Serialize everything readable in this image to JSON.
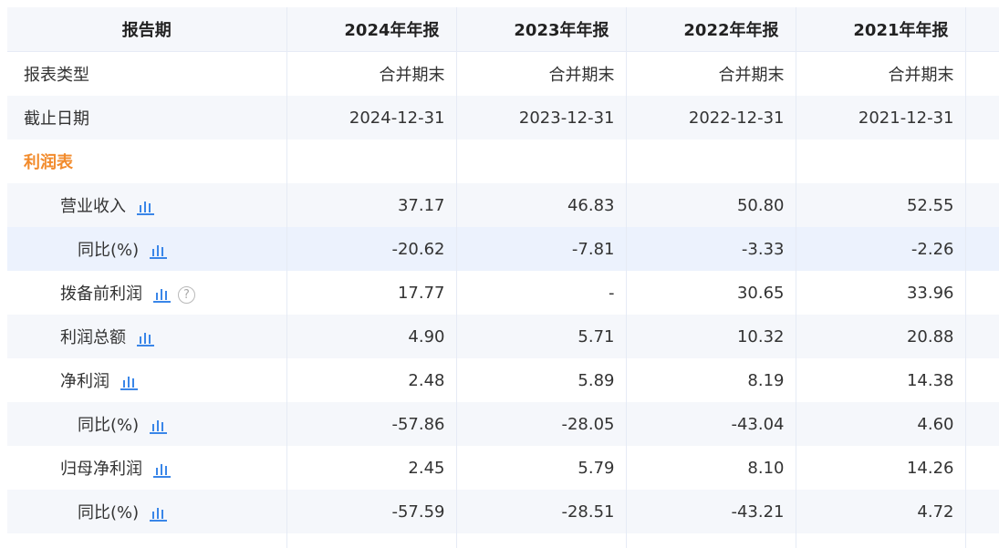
{
  "header": {
    "label": "报告期",
    "periods": [
      "2024年年报",
      "2023年年报",
      "2022年年报",
      "2021年年报"
    ]
  },
  "rows": {
    "report_type": {
      "label": "报表类型",
      "values": [
        "合并期末",
        "合并期末",
        "合并期末",
        "合并期末"
      ]
    },
    "end_date": {
      "label": "截止日期",
      "values": [
        "2024-12-31",
        "2023-12-31",
        "2022-12-31",
        "2021-12-31"
      ]
    },
    "section": {
      "label": "利润表"
    },
    "revenue": {
      "label": "营业收入",
      "values": [
        "37.17",
        "46.83",
        "50.80",
        "52.55"
      ],
      "icon": "bar-chart-icon"
    },
    "revenue_yoy": {
      "label": "同比(%)",
      "values": [
        "-20.62",
        "-7.81",
        "-3.33",
        "-2.26"
      ],
      "icon": "bar-chart-icon"
    },
    "pre_provision_profit": {
      "label": "拨备前利润",
      "values": [
        "17.77",
        "-",
        "30.65",
        "33.96"
      ],
      "icon": "bar-chart-icon",
      "help_icon": "question-icon"
    },
    "total_profit": {
      "label": "利润总额",
      "values": [
        "4.90",
        "5.71",
        "10.32",
        "20.88"
      ],
      "icon": "bar-chart-icon"
    },
    "net_profit": {
      "label": "净利润",
      "values": [
        "2.48",
        "5.89",
        "8.19",
        "14.38"
      ],
      "icon": "bar-chart-icon"
    },
    "net_profit_yoy": {
      "label": "同比(%)",
      "values": [
        "-57.86",
        "-28.05",
        "-43.04",
        "4.60"
      ],
      "icon": "bar-chart-icon"
    },
    "parent_net_profit": {
      "label": "归母净利润",
      "values": [
        "2.45",
        "5.79",
        "8.10",
        "14.26"
      ],
      "icon": "bar-chart-icon"
    },
    "parent_net_profit_yoy": {
      "label": "同比(%)",
      "values": [
        "-57.59",
        "-28.51",
        "-43.21",
        "4.72"
      ],
      "icon": "bar-chart-icon"
    }
  },
  "colors": {
    "accent_section": "#f28b2c",
    "icon_blue": "#3a86e8",
    "row_highlight": "#ecf2fd",
    "row_alt": "#f5f7fb"
  }
}
